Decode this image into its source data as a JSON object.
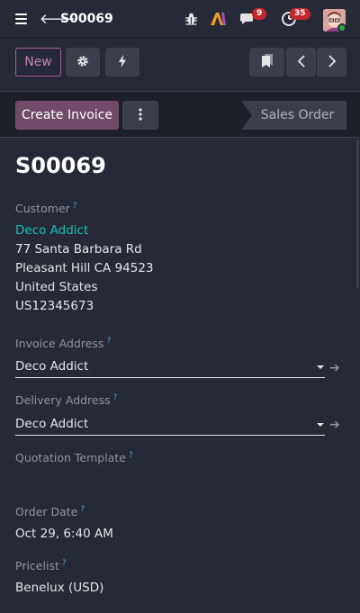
{
  "header": {
    "record_name": "S00069",
    "messages_count": "9",
    "activities_count": "35"
  },
  "controls": {
    "new_label": "New"
  },
  "statusbar": {
    "primary_label": "Create Invoice",
    "stage_label": "Sales Order"
  },
  "form": {
    "title": "S00069",
    "customer_label": "Customer",
    "customer_name": "Deco Addict",
    "address_lines": [
      "77 Santa Barbara Rd",
      "Pleasant Hill CA 94523",
      "United States",
      "US12345673"
    ],
    "invoice_address_label": "Invoice Address",
    "invoice_address_value": "Deco Addict",
    "delivery_address_label": "Delivery Address",
    "delivery_address_value": "Deco Addict",
    "quotation_template_label": "Quotation Template",
    "order_date_label": "Order Date",
    "order_date_value": "Oct 29, 6:40 AM",
    "pricelist_label": "Pricelist",
    "pricelist_value": "Benelux (USD)",
    "help_mark": "?"
  },
  "colors": {
    "accent": "#714b67",
    "link": "#17c1b5",
    "badge": "#c4282f",
    "background": "#262a36"
  },
  "icons": [
    "menu-icon",
    "back-arrow-icon",
    "bug-icon",
    "ai-icon",
    "chat-icon",
    "clock-icon",
    "gear-icon",
    "bolt-icon",
    "bookmark-icon",
    "chevron-left-icon",
    "chevron-right-icon",
    "vertical-dots-icon",
    "external-arrow-icon"
  ]
}
